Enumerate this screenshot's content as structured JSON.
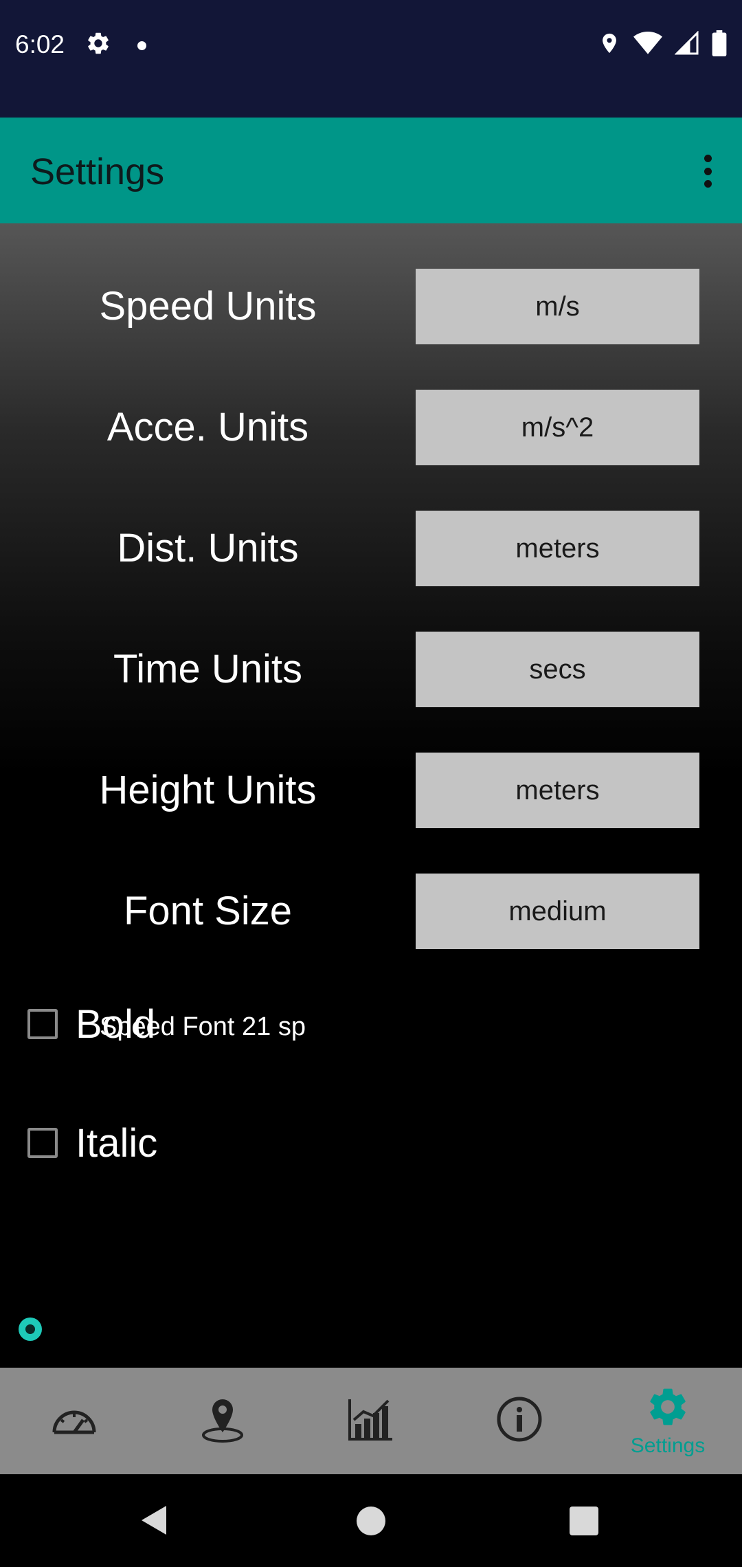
{
  "status_bar": {
    "time": "6:02",
    "icons": [
      "gear-icon",
      "dot-icon",
      "location-icon",
      "wifi-icon",
      "signal-icon",
      "battery-icon"
    ]
  },
  "app_bar": {
    "title": "Settings"
  },
  "settings": {
    "rows": [
      {
        "label": "Speed Units",
        "value": "m/s"
      },
      {
        "label": "Acce. Units",
        "value": "m/s^2"
      },
      {
        "label": "Dist. Units",
        "value": "meters"
      },
      {
        "label": "Time Units",
        "value": "secs"
      },
      {
        "label": "Height Units",
        "value": "meters"
      },
      {
        "label": "Font Size",
        "value": "medium"
      }
    ],
    "bold": {
      "label": "Bold",
      "checked": false
    },
    "italic": {
      "label": "Italic",
      "checked": false
    },
    "speed_font": "Speed Font 21 sp",
    "speed_font_slider_value": 0
  },
  "bottom_nav": {
    "items": [
      {
        "icon": "speedometer-icon",
        "label": ""
      },
      {
        "icon": "map-pin-icon",
        "label": ""
      },
      {
        "icon": "chart-icon",
        "label": ""
      },
      {
        "icon": "info-icon",
        "label": ""
      },
      {
        "icon": "gear-icon",
        "label": "Settings",
        "selected": true
      }
    ]
  },
  "colors": {
    "status_bar": "#121637",
    "app_bar": "#009688",
    "accent": "#009e91",
    "button_bg": "#c4c4c4",
    "nav_bg": "#8b8b8b"
  }
}
